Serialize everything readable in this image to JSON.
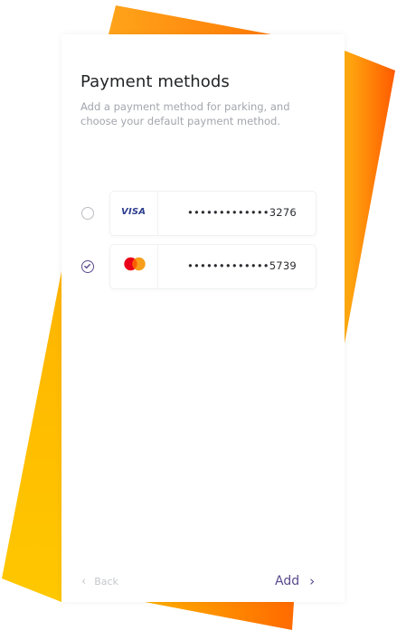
{
  "header": {
    "title": "Payment methods",
    "subtitle": "Add a payment method for parking, and choose your default payment method."
  },
  "payment_methods": [
    {
      "brand": "VISA",
      "brand_icon": "visa-logo",
      "masked_number": "•••••••••••••3276",
      "selected": false
    },
    {
      "brand": "",
      "brand_icon": "mastercard-logo",
      "masked_number": "•••••••••••••5739",
      "selected": true
    }
  ],
  "footer": {
    "back_label": "Back",
    "add_label": "Add"
  },
  "icons": {
    "back": "chevron-left-icon",
    "add": "chevron-right-icon",
    "selected": "check-circle-icon",
    "unselected": "radio-empty-icon"
  },
  "colors": {
    "accent": "#5b4a8e",
    "decoration_orange": "#ff6a00",
    "decoration_yellow": "#ffc400",
    "muted_text": "#a3a6ad"
  }
}
